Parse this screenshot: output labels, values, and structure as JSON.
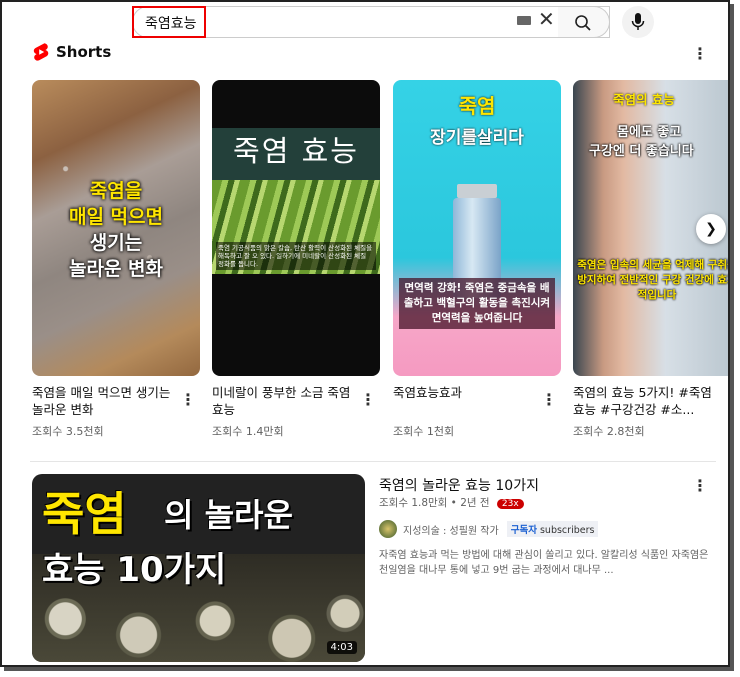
{
  "search": {
    "query": "죽염효능"
  },
  "shorts": {
    "section_title": "Shorts",
    "cards": [
      {
        "title": "죽염을 매일 먹으면 생기는 놀라운 변화",
        "views": "조회수 3.5천회",
        "overlay": [
          "죽염을",
          "매일 먹으면",
          "생기는",
          "놀라운 변화"
        ]
      },
      {
        "title": "미네랄이 풍부한 소금 죽염 효능",
        "views": "조회수 1.4만회",
        "overlay": [
          "죽염 효능"
        ],
        "caption": "죽염 기공식품의 맑은 칼슘, 탄산 활력이 산성화된 체질을 해독하고 잘 오 있다. 일하기에 미네랄이 산성화된 체질 정화를 돕니다."
      },
      {
        "title": "죽염효능효과",
        "views": "조회수 1천회",
        "overlay": [
          "죽염",
          "장기를살리다"
        ],
        "caption": "면역력 강화! 죽염은 중금속을 배출하고 백혈구의 활동을 촉진시켜 면역력을 높여줍니다"
      },
      {
        "title": "죽염의 효능 5가지! #죽염효능 #구강건강 #소...",
        "views": "조회수 2.8천회",
        "overlay": [
          "죽염의 효능",
          "몸에도 좋고",
          "구강엔 더 좋습니다"
        ],
        "caption": "죽염은 입속의 세균을 억제해 구취를 방지하여 전반적인 구강 건강에 효과적입니다"
      }
    ]
  },
  "video": {
    "title": "죽염의 놀라운 효능 10가지",
    "views": "조회수 1.8만회",
    "age": "2년 전",
    "badge": "23x",
    "channel": "지성의술 : 성필원 작가",
    "sub_kr": "구독자",
    "sub_en": "subscribers",
    "description": "자죽염 효능과 먹는 방법에 대해 관심이 쏠리고 있다. 알칼리성 식품인 자죽염은 천일염을 대나무 통에 넣고 9번 굽는 과정에서 대나무 ...",
    "duration": "4:03",
    "thumb_text": [
      "죽염",
      "의 놀라운",
      "효능 10가지"
    ]
  },
  "colors": {
    "accent": "#ff0000",
    "highlight_yellow": "#ffe600"
  }
}
